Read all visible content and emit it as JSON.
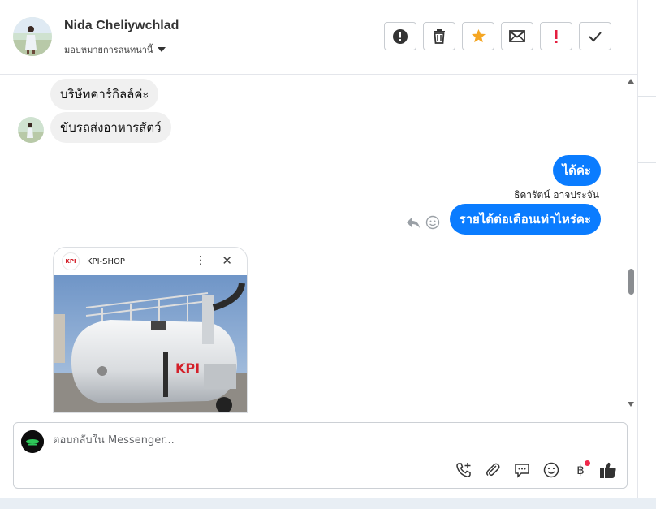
{
  "header": {
    "contact_name": "Nida Cheliywchlad",
    "assign_label": "มอบหมายการสนทนานี้"
  },
  "toolbar": {
    "buttons": [
      {
        "name": "report-spam-button",
        "icon": "alert-circle-icon",
        "color": "#333333"
      },
      {
        "name": "delete-button",
        "icon": "trash-icon",
        "color": "#333333"
      },
      {
        "name": "star-button",
        "icon": "star-icon",
        "color": "#f5a623"
      },
      {
        "name": "mark-unread-button",
        "icon": "envelope-icon",
        "color": "#333333"
      },
      {
        "name": "follow-up-button",
        "icon": "exclamation-icon",
        "color": "#e41e3f"
      },
      {
        "name": "mark-done-button",
        "icon": "check-icon",
        "color": "#333333"
      }
    ]
  },
  "messages": {
    "incoming": [
      {
        "text": "บริษัทคาร์กิลล์ค่ะ"
      },
      {
        "text": "ขับรถส่งอาหารสัตว์"
      }
    ],
    "outgoing": [
      {
        "text": "ได้ค่ะ"
      },
      {
        "text": "รายได้ต่อเดือนเท่าไหร่คะ"
      }
    ],
    "sender_name": "ธิดารัตน์ อาจประจัน",
    "colors": {
      "outgoing_bubble": "#0a7cff",
      "incoming_bubble": "#f0f0f0"
    }
  },
  "card": {
    "logo_text": "KPI",
    "shop_name": "KPI-SHOP",
    "truck_logo": "KPI"
  },
  "composer": {
    "placeholder": "ตอบกลับใน Messenger...",
    "icons": [
      "phone-add-icon",
      "attachment-icon",
      "saved-reply-icon",
      "emoji-icon",
      "baht-payment-icon",
      "thumbs-up-icon"
    ],
    "baht_symbol": "฿"
  }
}
